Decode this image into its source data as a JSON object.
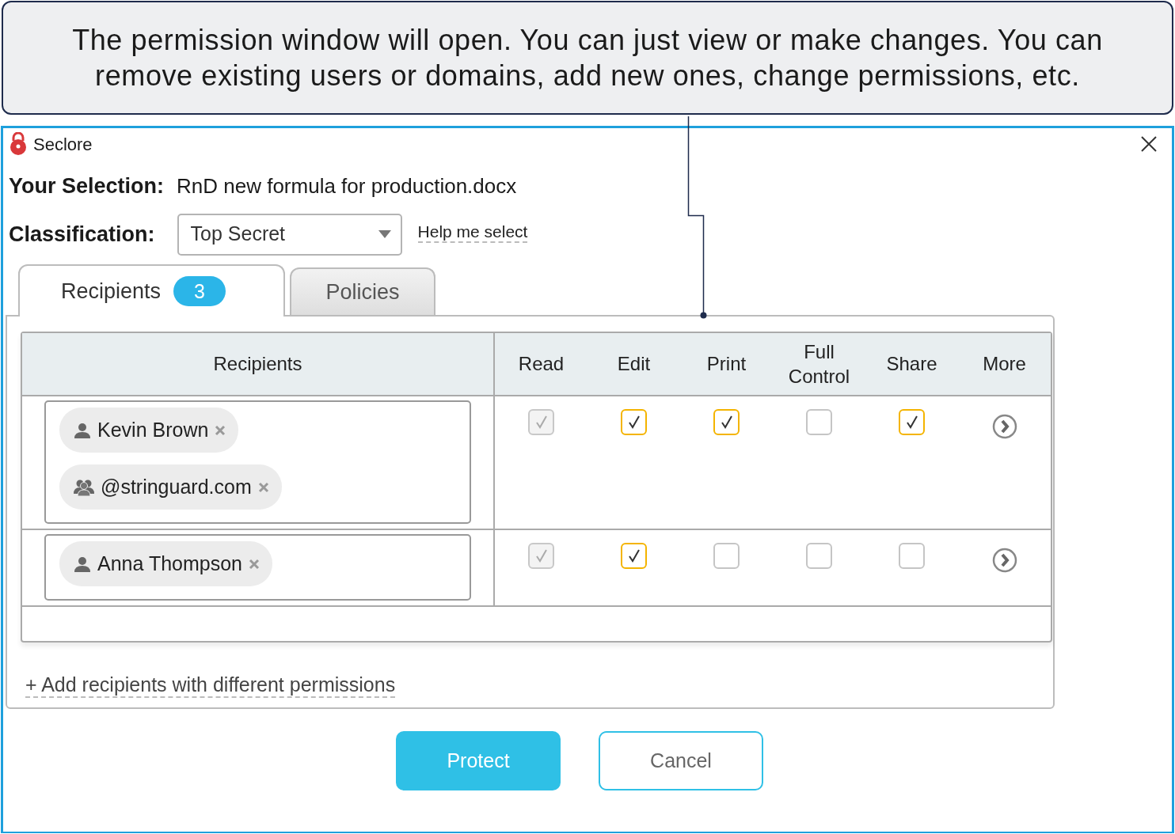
{
  "callout": {
    "text": "The permission window will open. You can just view or make changes. You can remove existing users or domains, add new ones, change permissions, etc."
  },
  "window": {
    "title": "Seclore"
  },
  "selection": {
    "label": "Your Selection:",
    "value": "RnD new formula for production.docx"
  },
  "classification": {
    "label": "Classification:",
    "value": "Top Secret",
    "help_link": "Help me select"
  },
  "tabs": [
    {
      "label": "Recipients",
      "badge": "3",
      "selected": true
    },
    {
      "label": "Policies",
      "selected": false
    }
  ],
  "table": {
    "columns": [
      "Recipients",
      "Read",
      "Edit",
      "Print",
      "Full Control",
      "Share",
      "More"
    ],
    "rows": [
      {
        "recipients": [
          {
            "kind": "user",
            "name": "Kevin Brown"
          },
          {
            "kind": "domain",
            "name": "@stringuard.com"
          }
        ],
        "permissions": [
          {
            "checked": true,
            "disabled": true
          },
          {
            "checked": true,
            "disabled": false
          },
          {
            "checked": true,
            "disabled": false
          },
          {
            "checked": false,
            "disabled": false
          },
          {
            "checked": true,
            "disabled": false
          }
        ]
      },
      {
        "recipients": [
          {
            "kind": "user",
            "name": "Anna Thompson"
          }
        ],
        "permissions": [
          {
            "checked": true,
            "disabled": true
          },
          {
            "checked": true,
            "disabled": false
          },
          {
            "checked": false,
            "disabled": false
          },
          {
            "checked": false,
            "disabled": false
          },
          {
            "checked": false,
            "disabled": false
          }
        ]
      }
    ]
  },
  "add_link": "+ Add recipients with different permissions",
  "buttons": [
    {
      "label": "Protect",
      "kind": "primary"
    },
    {
      "label": "Cancel",
      "kind": "secondary"
    }
  ]
}
